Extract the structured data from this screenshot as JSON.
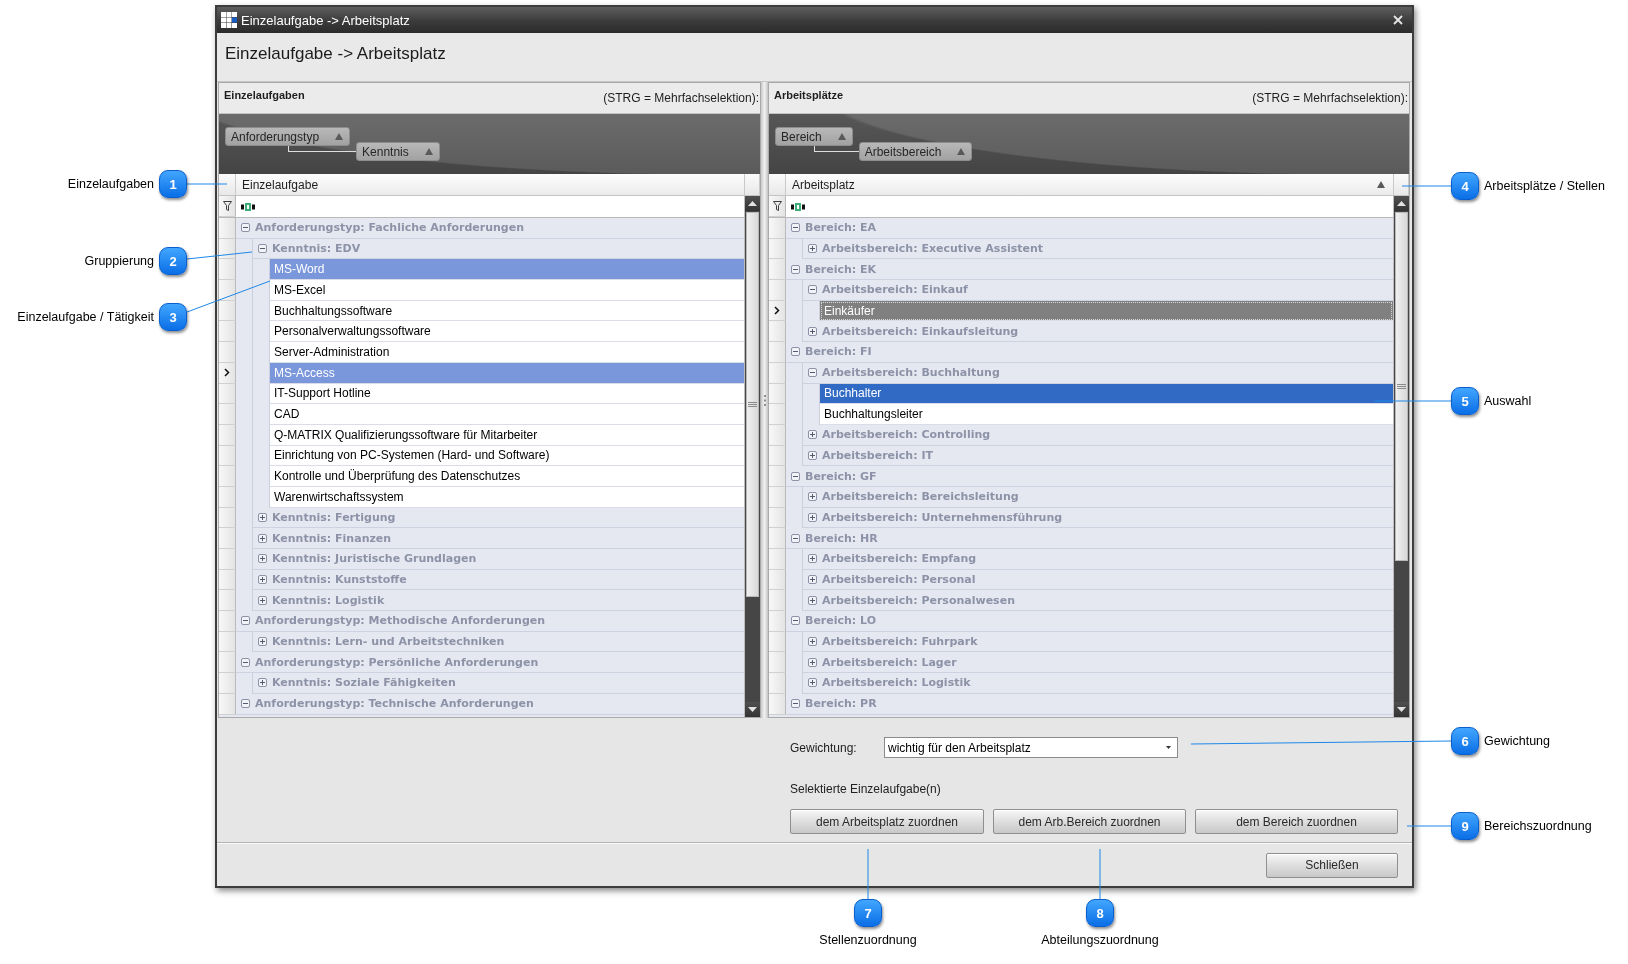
{
  "window": {
    "title": "Einzelaufgabe -> Arbeitsplatz"
  },
  "heading": "Einzelaufgabe -> Arbeitsplatz",
  "panels": [
    {
      "title": "Einzelaufgaben",
      "hint": "(STRG = Mehrfachselektion):",
      "active": false,
      "group_by": [
        {
          "label": "Anforderungstyp",
          "sorted": true
        },
        {
          "label": "Kenntnis",
          "sorted": true
        }
      ],
      "column": {
        "label": "Einzelaufgabe",
        "sorted": false
      },
      "rows": [
        {
          "kind": "group",
          "label": "Anforderungstyp: Fachliche Anforderungen",
          "expanded": true,
          "children": [
            {
              "kind": "group",
              "label": "Kenntnis: EDV",
              "expanded": true,
              "children": [
                {
                  "kind": "item",
                  "label": "MS-Word",
                  "selected": true,
                  "focused": false
                },
                {
                  "kind": "item",
                  "label": "MS-Excel",
                  "selected": false,
                  "focused": false
                },
                {
                  "kind": "item",
                  "label": "Buchhaltungssoftware",
                  "selected": false,
                  "focused": false
                },
                {
                  "kind": "item",
                  "label": "Personalverwaltungssoftware",
                  "selected": false,
                  "focused": false
                },
                {
                  "kind": "item",
                  "label": "Server-Administration",
                  "selected": false,
                  "focused": false
                },
                {
                  "kind": "item",
                  "label": "MS-Access",
                  "selected": true,
                  "focused": true
                },
                {
                  "kind": "item",
                  "label": "IT-Support Hotline",
                  "selected": false,
                  "focused": false
                },
                {
                  "kind": "item",
                  "label": "CAD",
                  "selected": false,
                  "focused": false
                },
                {
                  "kind": "item",
                  "label": "Q-MATRIX Qualifizierungssoftware für Mitarbeiter",
                  "selected": false,
                  "focused": false
                },
                {
                  "kind": "item",
                  "label": "Einrichtung von PC-Systemen (Hard- und Software)",
                  "selected": false,
                  "focused": false
                },
                {
                  "kind": "item",
                  "label": "Kontrolle und Überprüfung des Datenschutzes",
                  "selected": false,
                  "focused": false
                },
                {
                  "kind": "item",
                  "label": "Warenwirtschaftssystem",
                  "selected": false,
                  "focused": false
                }
              ]
            },
            {
              "kind": "group",
              "label": "Kenntnis: Fertigung",
              "expanded": false
            },
            {
              "kind": "group",
              "label": "Kenntnis: Finanzen",
              "expanded": false
            },
            {
              "kind": "group",
              "label": "Kenntnis: Juristische Grundlagen",
              "expanded": false
            },
            {
              "kind": "group",
              "label": "Kenntnis: Kunststoffe",
              "expanded": false
            },
            {
              "kind": "group",
              "label": "Kenntnis: Logistik",
              "expanded": false
            }
          ]
        },
        {
          "kind": "group",
          "label": "Anforderungstyp: Methodische Anforderungen",
          "expanded": true,
          "children": [
            {
              "kind": "group",
              "label": "Kenntnis: Lern- und Arbeitstechniken",
              "expanded": false
            }
          ]
        },
        {
          "kind": "group",
          "label": "Anforderungstyp: Persönliche Anforderungen",
          "expanded": true,
          "children": [
            {
              "kind": "group",
              "label": "Kenntnis: Soziale Fähigkeiten",
              "expanded": false
            }
          ]
        },
        {
          "kind": "group",
          "label": "Anforderungstyp: Technische Anforderungen",
          "expanded": true
        }
      ]
    },
    {
      "title": "Arbeitsplätze",
      "hint": "(STRG = Mehrfachselektion):",
      "active": true,
      "group_by": [
        {
          "label": "Bereich",
          "sorted": true
        },
        {
          "label": "Arbeitsbereich",
          "sorted": true
        }
      ],
      "column": {
        "label": "Arbeitsplatz",
        "sorted": true
      },
      "rows": [
        {
          "kind": "group",
          "label": "Bereich: EA",
          "expanded": true,
          "children": [
            {
              "kind": "group",
              "label": "Arbeitsbereich: Executive Assistent",
              "expanded": false
            }
          ]
        },
        {
          "kind": "group",
          "label": "Bereich: EK",
          "expanded": true,
          "children": [
            {
              "kind": "group",
              "label": "Arbeitsbereich: Einkauf",
              "expanded": true,
              "children": [
                {
                  "kind": "item",
                  "label": "Einkäufer",
                  "selected": false,
                  "focused": true
                }
              ]
            },
            {
              "kind": "group",
              "label": "Arbeitsbereich: Einkaufsleitung",
              "expanded": false
            }
          ]
        },
        {
          "kind": "group",
          "label": "Bereich: FI",
          "expanded": true,
          "children": [
            {
              "kind": "group",
              "label": "Arbeitsbereich: Buchhaltung",
              "expanded": true,
              "children": [
                {
                  "kind": "item",
                  "label": "Buchhalter",
                  "selected": true,
                  "focused": false
                },
                {
                  "kind": "item",
                  "label": "Buchhaltungsleiter",
                  "selected": false,
                  "focused": false
                }
              ]
            },
            {
              "kind": "group",
              "label": "Arbeitsbereich: Controlling",
              "expanded": false
            },
            {
              "kind": "group",
              "label": "Arbeitsbereich: IT",
              "expanded": false
            }
          ]
        },
        {
          "kind": "group",
          "label": "Bereich: GF",
          "expanded": true,
          "children": [
            {
              "kind": "group",
              "label": "Arbeitsbereich: Bereichsleitung",
              "expanded": false
            },
            {
              "kind": "group",
              "label": "Arbeitsbereich: Unternehmensführung",
              "expanded": false
            }
          ]
        },
        {
          "kind": "group",
          "label": "Bereich: HR",
          "expanded": true,
          "children": [
            {
              "kind": "group",
              "label": "Arbeitsbereich: Empfang",
              "expanded": false
            },
            {
              "kind": "group",
              "label": "Arbeitsbereich: Personal",
              "expanded": false
            },
            {
              "kind": "group",
              "label": "Arbeitsbereich: Personalwesen",
              "expanded": false
            }
          ]
        },
        {
          "kind": "group",
          "label": "Bereich: LO",
          "expanded": true,
          "children": [
            {
              "kind": "group",
              "label": "Arbeitsbereich: Fuhrpark",
              "expanded": false
            },
            {
              "kind": "group",
              "label": "Arbeitsbereich: Lager",
              "expanded": false
            },
            {
              "kind": "group",
              "label": "Arbeitsbereich: Logistik",
              "expanded": false
            }
          ]
        },
        {
          "kind": "group",
          "label": "Bereich: PR",
          "expanded": true
        }
      ]
    }
  ],
  "weighting": {
    "label": "Gewichtung:",
    "value": "wichtig für den Arbeitsplatz"
  },
  "selection_label": "Selektierte Einzelaufgabe(n)",
  "assign_buttons": [
    "dem Arbeitsplatz zuordnen",
    "dem Arb.Bereich zuordnen",
    "dem Bereich zuordnen"
  ],
  "close_button": "Schließen",
  "callouts": [
    {
      "number": "1",
      "label": "Einzelaufgaben"
    },
    {
      "number": "2",
      "label": "Gruppierung"
    },
    {
      "number": "3",
      "label": "Einzelaufgabe / Tätigkeit"
    },
    {
      "number": "4",
      "label": "Arbeitsplätze / Stellen"
    },
    {
      "number": "5",
      "label": "Auswahl"
    },
    {
      "number": "6",
      "label": "Gewichtung"
    },
    {
      "number": "7",
      "label": "Stellenzuordnung"
    },
    {
      "number": "8",
      "label": "Abteilungszuordnung"
    },
    {
      "number": "9",
      "label": "Bereichszuordnung"
    }
  ]
}
